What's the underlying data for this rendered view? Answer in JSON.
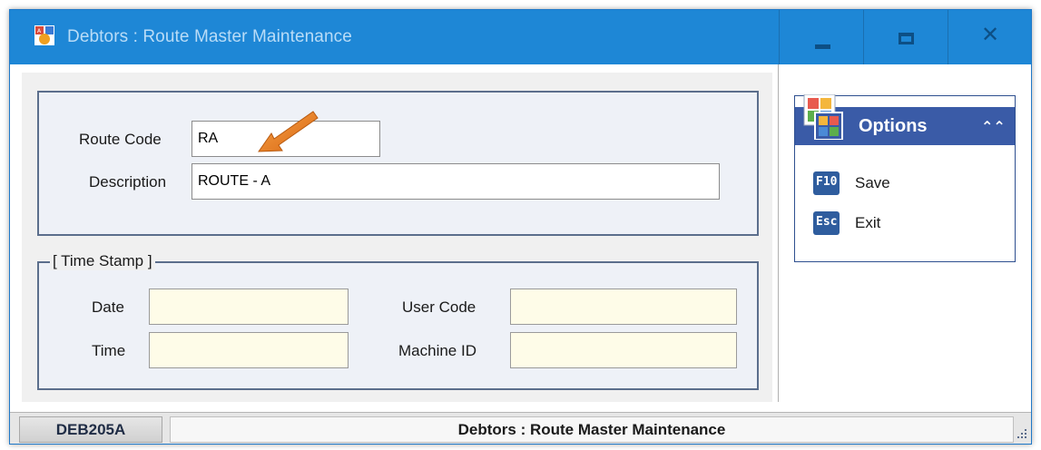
{
  "window": {
    "title": "Debtors : Route Master Maintenance"
  },
  "form": {
    "route_code_label": "Route Code",
    "route_code_value": "RA",
    "description_label": "Description",
    "description_value": "ROUTE - A"
  },
  "timestamp": {
    "legend": "[ Time Stamp ]",
    "date_label": "Date",
    "date_value": "",
    "time_label": "Time",
    "time_value": "",
    "user_code_label": "User Code",
    "user_code_value": "",
    "machine_id_label": "Machine ID",
    "machine_id_value": ""
  },
  "options": {
    "title": "Options",
    "collapse_icon": "double-chevron-up-icon",
    "items": [
      {
        "key": "F10",
        "label": "Save"
      },
      {
        "key": "Esc",
        "label": "Exit"
      }
    ]
  },
  "statusbar": {
    "code": "DEB205A",
    "title": "Debtors : Route Master Maintenance"
  },
  "colors": {
    "titlebar": "#1e87d6",
    "options_header": "#3a5ba7",
    "timestamp_field_bg": "#fefce8",
    "annotation_arrow": "#e87b1c"
  }
}
